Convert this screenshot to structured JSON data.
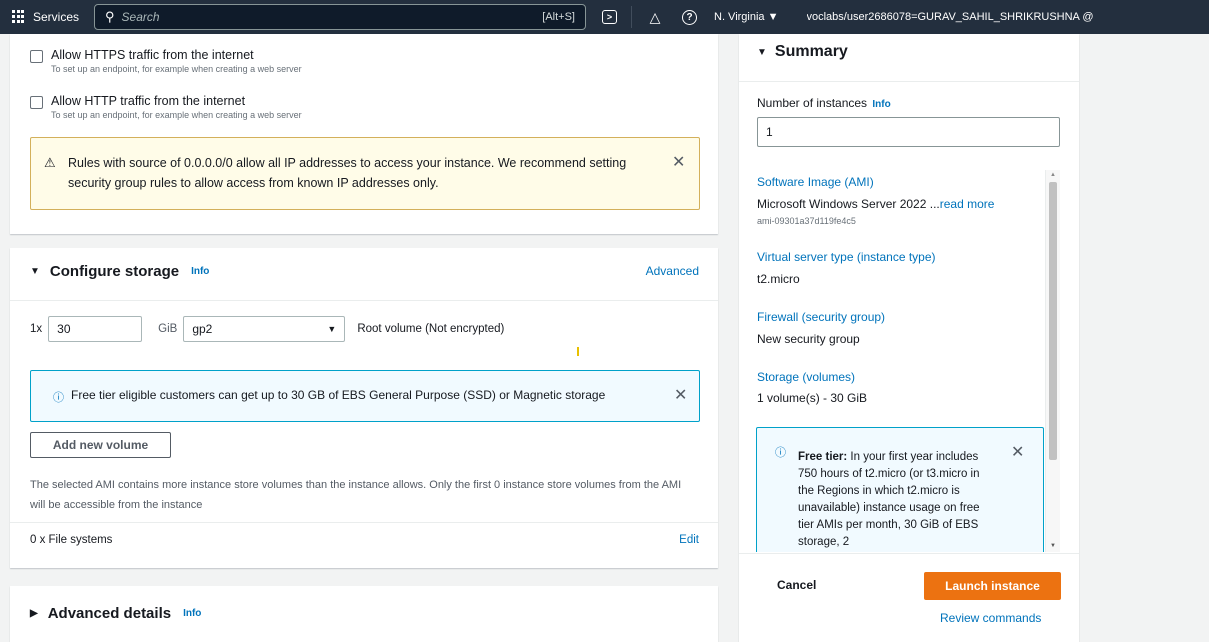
{
  "topbar": {
    "services_label": "Services",
    "search_placeholder": "Search",
    "search_shortcut": "[Alt+S]",
    "region": "N. Virginia ▼",
    "account": "voclabs/user2686078=GURAV_SAHIL_SHRIKRUSHNA @"
  },
  "network": {
    "https_label": "Allow HTTPS traffic from the internet",
    "https_desc": "To set up an endpoint, for example when creating a web server",
    "http_label": "Allow HTTP traffic from the internet",
    "http_desc": "To set up an endpoint, for example when creating a web server",
    "warning": "Rules with source of 0.0.0.0/0 allow all IP addresses to access your instance. We recommend setting security group rules to allow access from known IP addresses only."
  },
  "storage": {
    "title": "Configure storage",
    "info": "Info",
    "advanced": "Advanced",
    "multiplier": "1x",
    "size": "30",
    "unit": "GiB",
    "volume_type": "gp2",
    "root_label": "Root volume  (Not encrypted)",
    "free_tier_note": "Free tier eligible customers can get up to 30 GB of EBS General Purpose (SSD) or Magnetic storage",
    "add_volume": "Add new volume",
    "ami_note": "The selected AMI contains more instance store volumes than the instance allows. Only the first 0 instance store volumes from the AMI will be accessible from the instance",
    "file_systems": "0 x File systems",
    "edit": "Edit"
  },
  "advanced_details": {
    "title": "Advanced details",
    "info": "Info"
  },
  "summary": {
    "title": "Summary",
    "instances_label": "Number of instances",
    "instances_info": "Info",
    "instances_value": "1",
    "ami_label": "Software Image (AMI)",
    "ami_value": "Microsoft Windows Server 2022 ...",
    "ami_more": "read more",
    "ami_id": "ami-09301a37d119fe4c5",
    "type_label": "Virtual server type (instance type)",
    "type_value": "t2.micro",
    "firewall_label": "Firewall (security group)",
    "firewall_value": "New security group",
    "storage_label": "Storage (volumes)",
    "storage_value": "1 volume(s) - 30 GiB",
    "free_tier_bold": "Free tier:",
    "free_tier_text": " In your first year includes 750 hours of t2.micro (or t3.micro in the Regions in which t2.micro is unavailable) instance usage on free tier AMIs per month, 30 GiB of EBS storage, 2",
    "cancel": "Cancel",
    "launch": "Launch instance",
    "review": "Review commands"
  },
  "colors": {
    "nav_bg": "#232f3e",
    "link": "#0073bb",
    "primary_button": "#ec7211",
    "warning_bg": "#fffce8",
    "info_bg": "#f1faff"
  }
}
